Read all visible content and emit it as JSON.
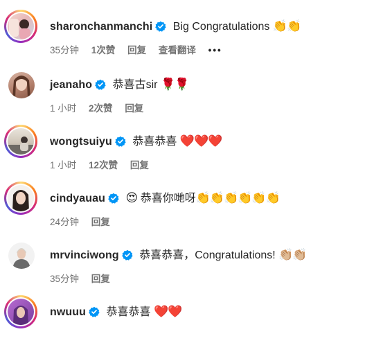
{
  "comments": [
    {
      "username": "sharonchanmanchi",
      "text": "Big Congratulations",
      "emoji": "👏👏",
      "time": "35分钟",
      "likes": "1次赞",
      "reply": "回复",
      "translate": "查看翻译",
      "more": "•••",
      "avatar_style": "ring"
    },
    {
      "username": "jeanaho",
      "text": "恭喜古sir",
      "emoji": "🌹🌹",
      "time": "1 小时",
      "likes": "2次赞",
      "reply": "回复",
      "avatar_style": "plain"
    },
    {
      "username": "wongtsuiyu",
      "text": "恭喜恭喜",
      "emoji": "❤️❤️❤️",
      "time": "1 小时",
      "likes": "12次赞",
      "reply": "回复",
      "avatar_style": "ring"
    },
    {
      "username": "cindyauau",
      "emoji_lead": "😍",
      "text": "恭喜你哋呀",
      "emoji": "👏👏👏👏👏👏",
      "time": "24分钟",
      "reply": "回复",
      "avatar_style": "ring"
    },
    {
      "username": "mrvinciwong",
      "text": "恭喜恭喜，Congratulations!",
      "emoji": "👏🏼👏🏼",
      "time": "35分钟",
      "reply": "回复",
      "avatar_style": "plain"
    },
    {
      "username": "nwuuu",
      "text": "恭喜恭喜",
      "emoji": "❤️❤️",
      "avatar_style": "ring"
    }
  ],
  "colors": {
    "verified": "#0095f6",
    "meta": "#737373",
    "heart": "#ed1c24"
  }
}
